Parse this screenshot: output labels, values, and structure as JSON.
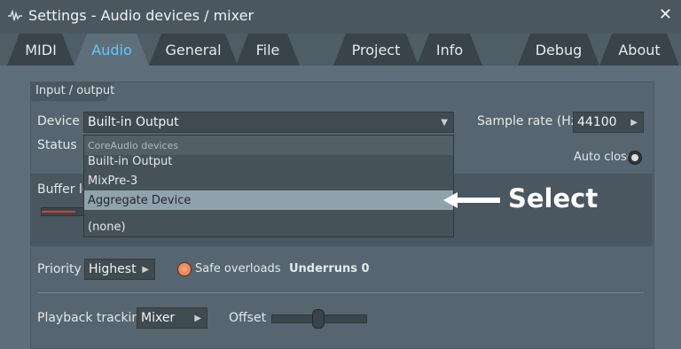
{
  "window": {
    "title": "Settings - Audio devices / mixer",
    "close_icon": "close-icon"
  },
  "tabs": [
    "MIDI",
    "Audio",
    "General",
    "File",
    "Project",
    "Info",
    "Debug",
    "About"
  ],
  "active_tab": "Audio",
  "section": {
    "title": "Input / output"
  },
  "device": {
    "label": "Device",
    "value": "Built-in Output"
  },
  "sample_rate": {
    "label": "Sample rate (Hz)",
    "value": "44100"
  },
  "status": {
    "label": "Status"
  },
  "auto_close": {
    "label": "Auto close"
  },
  "buffer": {
    "label_partial": "Buffer le"
  },
  "dropdown": {
    "group": "CoreAudio devices",
    "items": [
      "Built-in Output",
      "MixPre-3",
      "Aggregate Device",
      "(none)"
    ],
    "selected": "Aggregate Device"
  },
  "annotation": {
    "text": "Select"
  },
  "priority": {
    "label": "Priority",
    "value": "Highest"
  },
  "safe_overloads": {
    "label": "Safe overloads"
  },
  "underruns": {
    "label": "Underruns 0"
  },
  "playback_tracking": {
    "label": "Playback tracking",
    "value": "Mixer"
  },
  "offset": {
    "label": "Offset",
    "level": 0.5
  },
  "colors": {
    "accent": "#5fc8ff",
    "selected_row": "#90a3ad",
    "safe_overloads": "#f08b5b"
  }
}
